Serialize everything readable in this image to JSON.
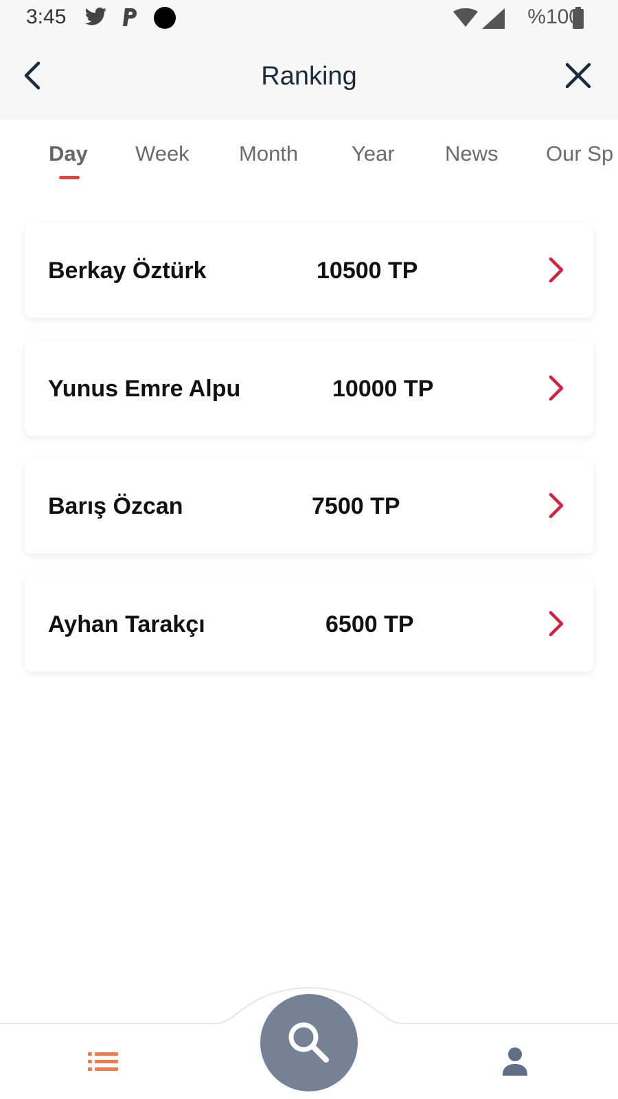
{
  "status_bar": {
    "time": "3:45",
    "battery": "%100",
    "icons": [
      "twitter-icon",
      "p-app-icon",
      "dot-icon",
      "wifi-icon",
      "signal-icon",
      "battery-icon"
    ]
  },
  "header": {
    "title": "Ranking",
    "back_icon": "chevron-left-icon",
    "close_icon": "close-icon"
  },
  "tabs": [
    {
      "label": "Day",
      "active": true
    },
    {
      "label": "Week",
      "active": false
    },
    {
      "label": "Month",
      "active": false
    },
    {
      "label": "Year",
      "active": false
    },
    {
      "label": "News",
      "active": false
    },
    {
      "label": "Our Sp",
      "active": false
    }
  ],
  "ranking": [
    {
      "name": "Berkay Öztürk",
      "points": "10500 TP"
    },
    {
      "name": "Yunus Emre Alpu",
      "points": "10000 TP"
    },
    {
      "name": "Barış Özcan",
      "points": "7500 TP"
    },
    {
      "name": "Ayhan Tarakçı",
      "points": "6500 TP"
    }
  ],
  "bottom_nav": {
    "left_icon": "list-icon",
    "center_icon": "search-icon",
    "right_icon": "user-icon"
  },
  "colors": {
    "accent": "#e0443d",
    "chevron": "#d6203f",
    "fab": "#758296",
    "menu_icon": "#f07a48",
    "profile_icon": "#5f6f85",
    "header_bg": "#f7f7f7"
  }
}
